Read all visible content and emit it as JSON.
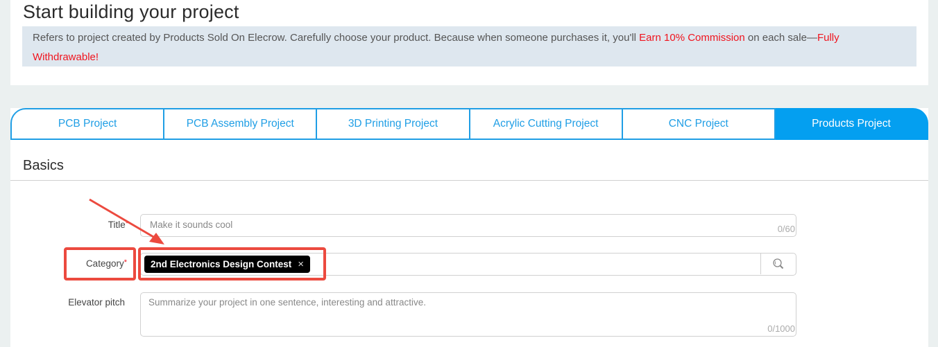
{
  "header": {
    "title": "Start building your project",
    "notice": {
      "text_1": "Refers to project created by Products Sold On Elecrow. Carefully choose your product. Because when someone purchases it, you'll ",
      "highlight_1": "Earn 10% Commission",
      "text_2": " on each sale—",
      "highlight_2": "Fully Withdrawable!"
    }
  },
  "tabs": [
    {
      "label": "PCB Project",
      "active": false
    },
    {
      "label": "PCB Assembly Project",
      "active": false
    },
    {
      "label": "3D Printing Project",
      "active": false
    },
    {
      "label": "Acrylic Cutting Project",
      "active": false
    },
    {
      "label": "CNC Project",
      "active": false
    },
    {
      "label": "Products Project",
      "active": true
    }
  ],
  "section": {
    "title": "Basics"
  },
  "form": {
    "title_field": {
      "label": "Title",
      "required_mark": "*",
      "value": "",
      "placeholder": "Make it sounds cool",
      "counter": "0/60"
    },
    "category_field": {
      "label": "Category",
      "required_mark": "*",
      "selected_tag": "2nd Electronics Design Contest",
      "remove_glyph": "×",
      "search_icon": "search-icon"
    },
    "elevator_pitch_field": {
      "label": "Elevator pitch",
      "value": "",
      "placeholder": "Summarize your project in one sentence, interesting and attractive.",
      "counter": "0/1000"
    }
  },
  "colors": {
    "accent": "#049ff0",
    "tab_border": "#1f9ee5",
    "highlight_red": "#f0141e",
    "annotation_red": "#ec4a3f",
    "notice_bg": "#dee7ef",
    "page_bg": "#ebf0f0"
  }
}
